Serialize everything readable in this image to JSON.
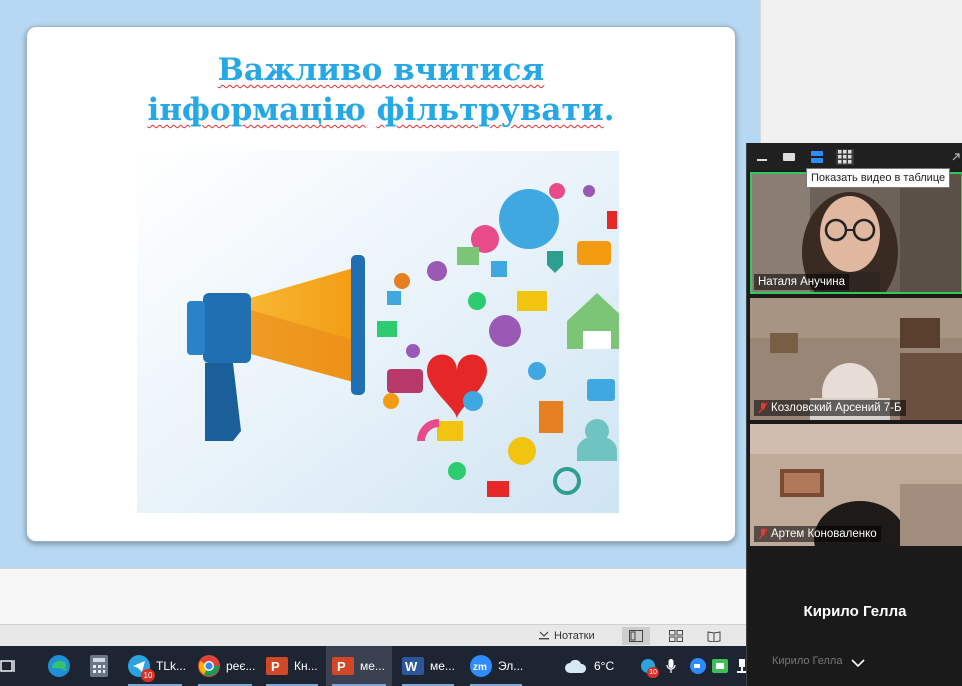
{
  "slide": {
    "title_line1": "Важливо вчитися",
    "title_line2a": "інформацію",
    "title_line2b": "фільтрувати",
    "title_line2c": ".",
    "image_icon": "megaphone-social-media-illustration"
  },
  "statusbar": {
    "notes_label": "Нотатки"
  },
  "taskbar": {
    "items": [
      {
        "label": "TLk...",
        "badge": "10",
        "icon": "telegram-icon"
      },
      {
        "label": "реє...",
        "icon": "chrome-icon"
      },
      {
        "label": "Кн...",
        "icon": "powerpoint-icon"
      },
      {
        "label": "ме...",
        "icon": "powerpoint-icon"
      },
      {
        "label": "ме...",
        "icon": "word-icon"
      },
      {
        "label": "Эл...",
        "icon": "zoom-icon"
      }
    ],
    "weather": "6°C",
    "tray_badge": "10"
  },
  "zoom": {
    "tooltip": "Показать видео в таблице",
    "participants": [
      {
        "name": "Наталя Анучина",
        "muted": false
      },
      {
        "name": "Козловский Арсений 7-Б",
        "muted": true
      },
      {
        "name": "Артем Коноваленко",
        "muted": true
      }
    ],
    "audio_only_name": "Кирило Гелла",
    "ghost_name": "Кирило Гелла"
  },
  "colors": {
    "title": "#26a8e6",
    "speaking_border": "#34c759",
    "taskbar": "#1d2532"
  }
}
